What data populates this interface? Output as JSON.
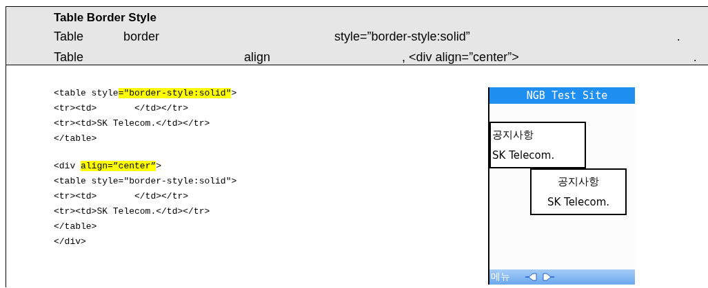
{
  "header": {
    "title": "Table Border Style",
    "lines": [
      [
        "Table",
        "border",
        "style=”border-style:solid”",
        "."
      ],
      [
        "Table",
        "align",
        ", <div align=”center”>",
        "."
      ]
    ]
  },
  "code_blocks": [
    [
      [
        {
          "text": "<table style",
          "highlight": false
        },
        {
          "text": "=\"border-style:solid\"",
          "highlight": true
        },
        {
          "text": ">",
          "highlight": false
        }
      ],
      [
        {
          "text": "<tr><td>       </td></tr>",
          "highlight": false
        }
      ],
      [
        {
          "text": "<tr><td>SK Telecom.</td></tr>",
          "highlight": false
        }
      ],
      [
        {
          "text": "</table>",
          "highlight": false
        }
      ]
    ],
    [
      [
        {
          "text": "<div ",
          "highlight": false
        },
        {
          "text": "align=”center”",
          "highlight": true
        },
        {
          "text": ">",
          "highlight": false
        }
      ],
      [
        {
          "text": "<table style=\"border-style:solid\">",
          "highlight": false
        }
      ],
      [
        {
          "text": "<tr><td>       </td></tr>",
          "highlight": false
        }
      ],
      [
        {
          "text": "<tr><td>SK Telecom.</td></tr>",
          "highlight": false
        }
      ],
      [
        {
          "text": "</table>",
          "highlight": false
        }
      ],
      [
        {
          "text": "</div>",
          "highlight": false
        }
      ]
    ]
  ],
  "phone": {
    "title": "NGB Test Site",
    "tables": [
      {
        "kind": "left",
        "rows": [
          "공지사항",
          "SK Telecom."
        ]
      },
      {
        "kind": "centered",
        "rows": [
          "공지사항",
          "SK Telecom."
        ]
      }
    ],
    "softkey": "메뉴"
  }
}
